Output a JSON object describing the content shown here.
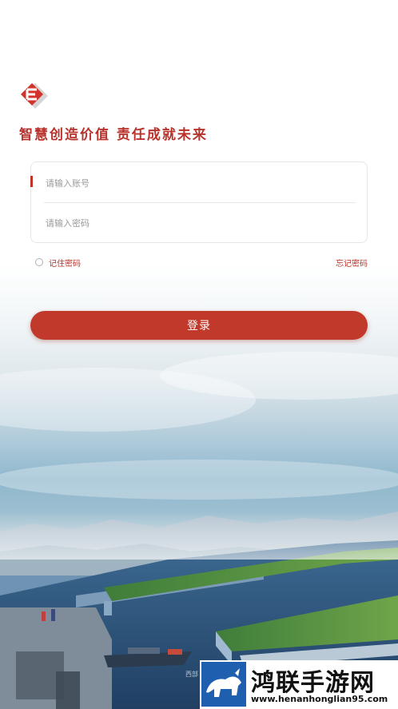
{
  "app": {
    "slogan": "智慧创造价值 责任成就未来"
  },
  "login_form": {
    "account_placeholder": "请输入账号",
    "password_placeholder": "请输入密码",
    "remember_label": "记住密码",
    "forgot_label": "忘记密码",
    "submit_label": "登录"
  },
  "background": {
    "caption": "西部"
  },
  "watermark": {
    "title": "鸿联手游网",
    "url": "www.henanhonglian95.com"
  },
  "colors": {
    "brand_red": "#c0392b",
    "text_red": "#b7332b"
  },
  "icons": {
    "logo": "brand-logo-icon",
    "remember": "radio-circle-icon",
    "watermark": "buffalo-logo-icon"
  }
}
